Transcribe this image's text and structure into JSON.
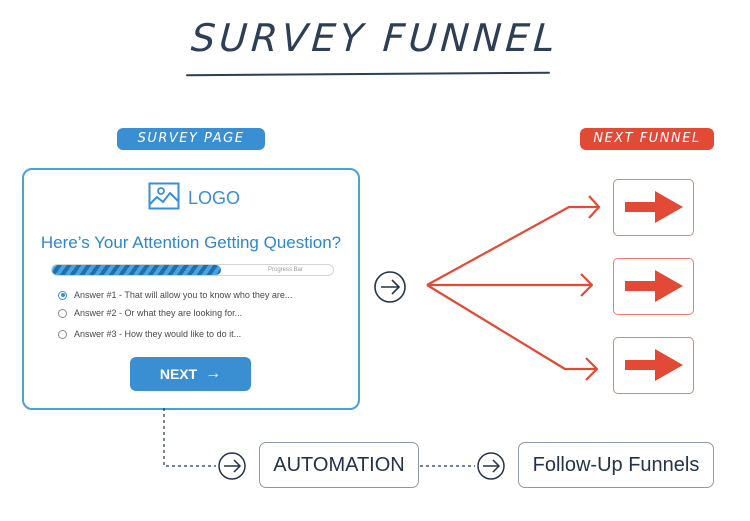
{
  "title": "SURVEY FUNNEL",
  "labels": {
    "survey_page": "SURVEY PAGE",
    "next_funnel": "NEXT FUNNEL"
  },
  "survey_card": {
    "logo_icon": "image-icon",
    "logo_text": "LOGO",
    "question": "Here’s Your Attention Getting Question?",
    "progress": {
      "label": "Progress Bar",
      "percent": 60
    },
    "answers": [
      {
        "label": "Answer #1 - That will allow you to know who they are...",
        "selected": true
      },
      {
        "label": "Answer #2 - Or what they are looking for...",
        "selected": false
      },
      {
        "label": "Answer #3 - How they would like to do it...",
        "selected": false
      }
    ],
    "next_button": {
      "label": "NEXT",
      "icon": "arrow-right-icon",
      "arrow_glyph": "→"
    }
  },
  "next_funnels": [
    {
      "icon": "arrow-right-icon"
    },
    {
      "icon": "arrow-right-icon"
    },
    {
      "icon": "arrow-right-icon"
    }
  ],
  "flow": {
    "automation": "AUTOMATION",
    "follow_up": "Follow-Up Funnels"
  },
  "colors": {
    "title": "#2d3e55",
    "survey_blue": "#3a8fd3",
    "funnel_red": "#e24a36",
    "flow_text": "#243349"
  }
}
